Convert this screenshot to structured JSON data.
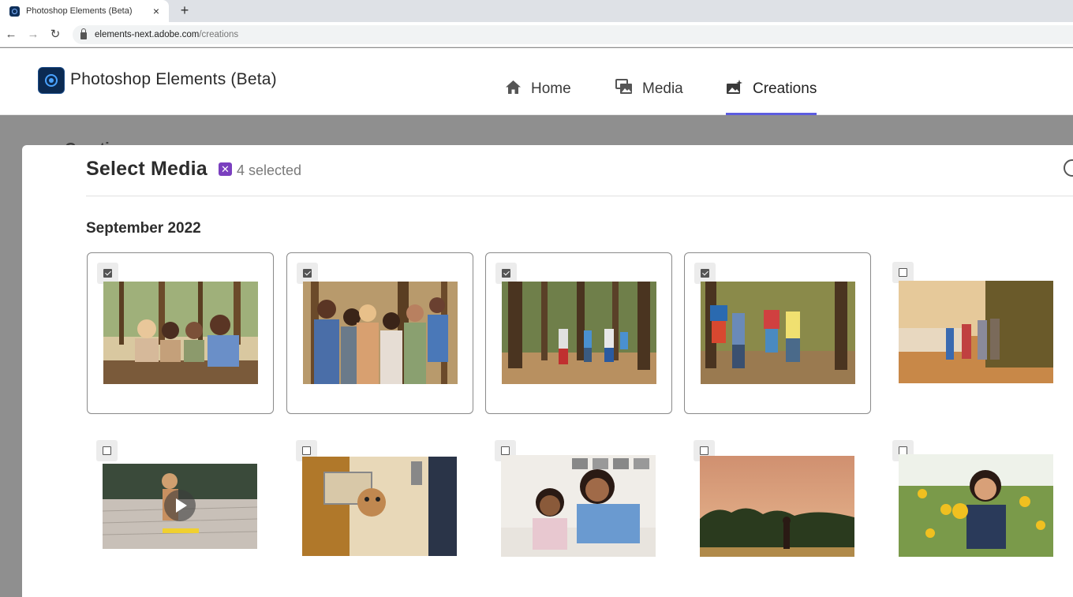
{
  "browser": {
    "tab_title": "Photoshop Elements (Beta)",
    "tab_close": "×",
    "new_tab": "+",
    "url_host": "elements-next.adobe.com",
    "url_path": "/creations",
    "back": "←",
    "forward": "→",
    "reload": "↻"
  },
  "app": {
    "title": "Photoshop Elements (Beta)",
    "nav": [
      {
        "label": "Home",
        "icon": "home-icon"
      },
      {
        "label": "Media",
        "icon": "media-icon"
      },
      {
        "label": "Creations",
        "icon": "creations-icon",
        "active": true
      }
    ],
    "behind_heading": "Creations"
  },
  "modal": {
    "title": "Select Media",
    "badge_symbol": "✕",
    "selected_label": "4 selected",
    "section": "September 2022"
  },
  "media": [
    {
      "name": "family-picnic-photo",
      "selected": true,
      "type": "photo"
    },
    {
      "name": "group-selfie-photo",
      "selected": true,
      "type": "photo"
    },
    {
      "name": "forest-walk-photo",
      "selected": true,
      "type": "photo"
    },
    {
      "name": "kids-playing-photo",
      "selected": true,
      "type": "photo"
    },
    {
      "name": "lakeside-family-photo",
      "selected": false,
      "type": "photo"
    },
    {
      "name": "dog-skateboard-video",
      "selected": false,
      "type": "video"
    },
    {
      "name": "dog-car-window-photo",
      "selected": false,
      "type": "photo"
    },
    {
      "name": "mother-daughter-photo",
      "selected": false,
      "type": "photo"
    },
    {
      "name": "sunset-field-photo",
      "selected": false,
      "type": "photo"
    },
    {
      "name": "girl-flowers-photo",
      "selected": false,
      "type": "photo"
    }
  ],
  "colors": {
    "accent": "#5c5ce0",
    "badge": "#7a3fbf"
  }
}
